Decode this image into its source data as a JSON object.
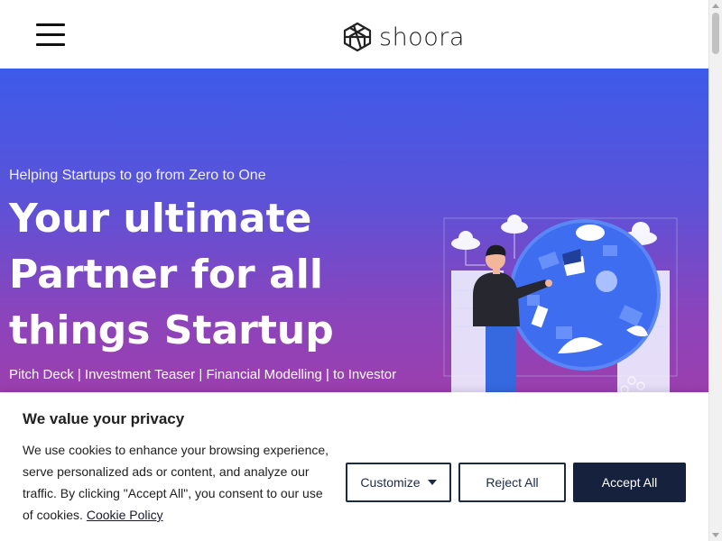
{
  "header": {
    "brand": "shoora",
    "menu_icon": "hamburger-menu-icon",
    "logo_icon": "shoora-logo-mark-icon"
  },
  "hero": {
    "eyebrow": "Helping Startups to go from Zero to One",
    "title_line1": "Your ultimate",
    "title_line2": "Partner for all",
    "title_line3": "things Startup",
    "services": "Pitch Deck | Investment Teaser | Financial Modelling | to Investor",
    "illustration_icon": "man-with-globe-illustration",
    "gradient_top": "#3d5bea",
    "gradient_bottom": "#9c3fae"
  },
  "consent": {
    "title": "We value your privacy",
    "body": "We use cookies to enhance your browsing experience, serve personalized ads or content, and analyze our traffic. By clicking \"Accept All\", you consent to our use of cookies.",
    "policy_link": "Cookie Policy",
    "customize_label": "Customize",
    "reject_label": "Reject All",
    "accept_label": "Accept All",
    "accent": "#15213d"
  }
}
